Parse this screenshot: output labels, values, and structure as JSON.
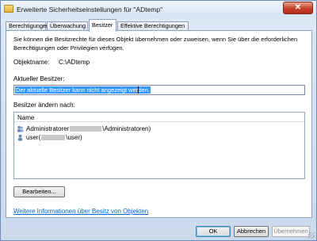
{
  "window": {
    "title": "Erweiterte Sicherheitseinstellungen für \"ADtemp\"",
    "close_label": "✕"
  },
  "tabs": [
    {
      "label": "Berechtigungen",
      "active": false
    },
    {
      "label": "Überwachung",
      "active": false
    },
    {
      "label": "Besitzer",
      "active": true
    },
    {
      "label": "Effektive Berechtigungen",
      "active": false
    }
  ],
  "intro_text": "Sie können die Besitzrechte für dieses Objekt übernehmen oder zuweisen, wenn Sie über die erforderlichen Berechtigungen oder Privilegien verfügen.",
  "object_name": {
    "label": "Objektname:",
    "value": "C:\\ADtemp"
  },
  "current_owner": {
    "label": "Aktueller Besitzer:",
    "value": "Der aktuelle Besitzer kann nicht angezeigt werden."
  },
  "change_owner": {
    "label": "Besitzer ändern nach:",
    "column_header": "Name",
    "items": [
      {
        "name_prefix": "Administratorer",
        "name_suffix": "\\Administratoren)",
        "icon": "group-users-icon"
      },
      {
        "name_prefix": "user(",
        "name_suffix": "\\user)",
        "icon": "user-icon"
      }
    ]
  },
  "edit_button": "Bearbeiten...",
  "more_info_link": "Weitere Informationen über Besitz von Objekten",
  "buttons": {
    "ok": "OK",
    "cancel": "Abbrechen",
    "apply": "Übernehmen"
  }
}
